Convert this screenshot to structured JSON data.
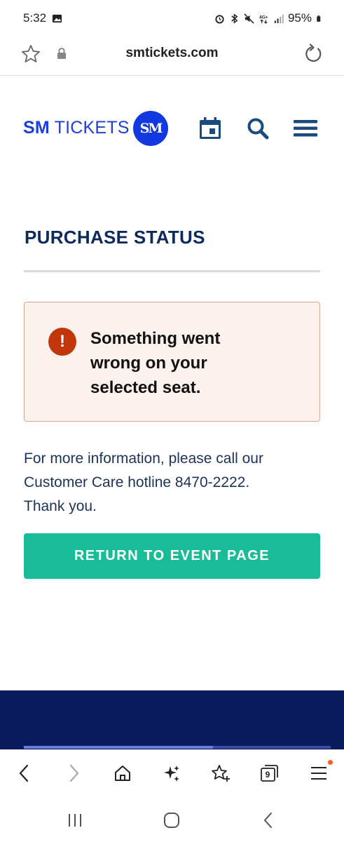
{
  "status_bar": {
    "time": "5:32",
    "battery": "95%"
  },
  "browser": {
    "url": "smtickets.com",
    "tab_count": "9"
  },
  "site": {
    "logo_sm": "SM",
    "logo_tickets": "TICKETS",
    "logo_mark": "SM",
    "brand_color": "#1e40d8",
    "nav_color": "#1b4b7e"
  },
  "main": {
    "title": "PURCHASE STATUS",
    "alert": {
      "line1": "Something went",
      "line2": "wrong on your",
      "line3": "selected seat.",
      "color": "#c2360c"
    },
    "info": {
      "line1": "For more information, please call our",
      "line2": "Customer Care hotline 8470-2222.",
      "line3": "Thank you."
    },
    "return_button": "RETURN TO EVENT PAGE",
    "button_color": "#19bc96"
  },
  "icons": {
    "status": [
      "gallery-icon",
      "alarm-icon",
      "bluetooth-icon",
      "mute-icon",
      "4g-icon",
      "signal-icon",
      "battery-icon"
    ],
    "header": [
      "calendar-icon",
      "search-icon",
      "menu-icon"
    ],
    "toolbar": [
      "back-icon",
      "forward-icon",
      "home-icon",
      "sparkle-icon",
      "bookmark-add-icon",
      "tabs-icon",
      "more-icon"
    ],
    "system": [
      "recents-icon",
      "home-circle-icon",
      "system-back-icon"
    ]
  }
}
